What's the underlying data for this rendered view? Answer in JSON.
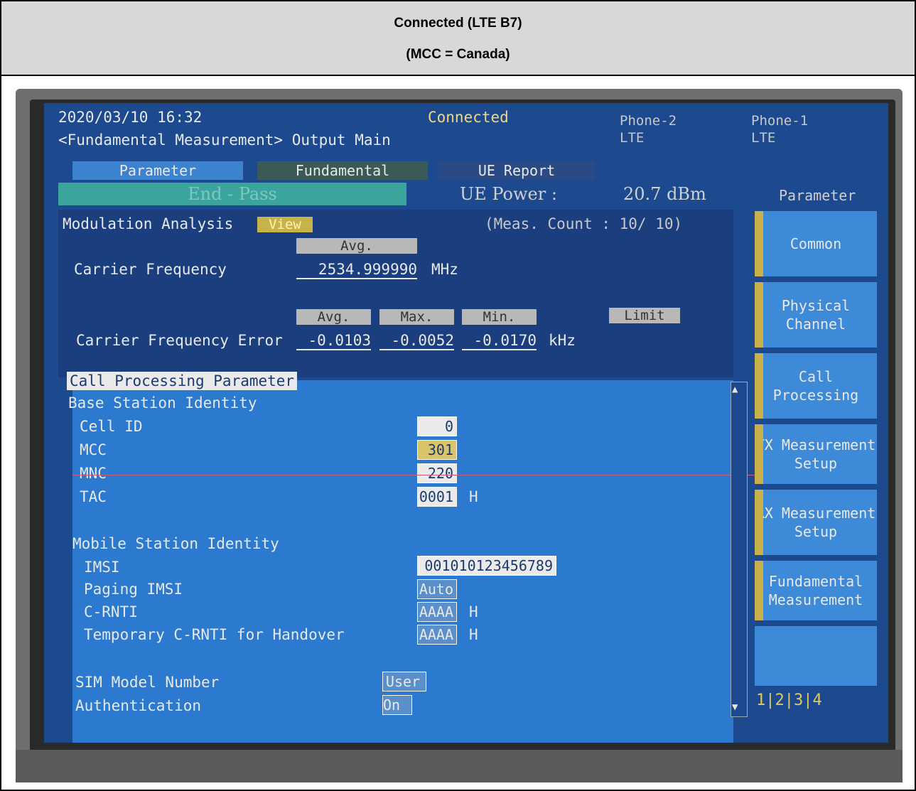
{
  "caption": {
    "title": "Connected (LTE B7)",
    "subtitle": "(MCC = Canada)"
  },
  "status": {
    "datetime": "2020/03/10 16:32",
    "connection": "Connected",
    "screen_title": "<Fundamental Measurement> Output Main",
    "phone2": "Phone-2",
    "phone2_tech": "LTE",
    "phone1": "Phone-1",
    "phone1_tech": "LTE"
  },
  "tabs": [
    "Parameter",
    "Fundamental",
    "UE Report"
  ],
  "measurement": {
    "state": "End - Pass",
    "ue_power_label": "UE Power :",
    "ue_power_value": "20.7 dBm"
  },
  "modulation": {
    "title": "Modulation Analysis",
    "view": "View",
    "meas_count": "(Meas. Count :   10/  10)",
    "avg_header": "Avg.",
    "carrier_freq_label": "Carrier Frequency",
    "carrier_freq_value": "2534.999990",
    "carrier_freq_unit": "MHz",
    "cols": [
      "Avg.",
      "Max.",
      "Min."
    ],
    "limit": "Limit",
    "cfe_label": "Carrier Frequency Error",
    "cfe_avg": "-0.0103",
    "cfe_max": "-0.0052",
    "cfe_min": "-0.0170",
    "cfe_unit": "kHz"
  },
  "call": {
    "title": "Call Processing Parameter",
    "bs_heading": "Base Station Identity",
    "cell_id_label": "Cell ID",
    "cell_id": "0",
    "mcc_label": "MCC",
    "mcc": "301",
    "mnc_label": "MNC",
    "mnc": "220",
    "tac_label": "TAC",
    "tac": "0001",
    "hex_unit": "H",
    "ms_heading": "Mobile Station Identity",
    "imsi_label": "IMSI",
    "imsi": "001010123456789",
    "paging_imsi_label": "Paging IMSI",
    "paging_imsi": "Auto",
    "c_rnti_label": "C-RNTI",
    "c_rnti": "AAAA",
    "temp_c_rnti_label": "Temporary C-RNTI for Handover",
    "temp_c_rnti": "AAAA",
    "sim_model_label": "SIM Model Number",
    "sim_model": "User",
    "auth_label": "Authentication",
    "auth": "On"
  },
  "side": {
    "title": "Parameter",
    "items": [
      "Common",
      "Physical Channel",
      "Call Processing",
      "TX Measurement Setup",
      "RX Measurement Setup",
      "Fundamental Measurement"
    ],
    "pages": "1|2|3|4"
  }
}
